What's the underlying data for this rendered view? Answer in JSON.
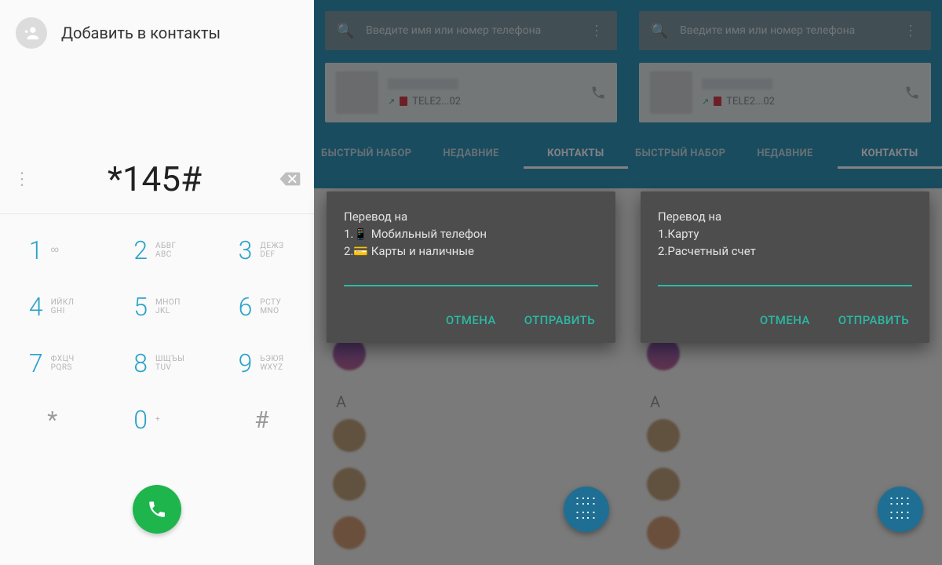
{
  "dialer": {
    "add_contact_label": "Добавить в контакты",
    "entered_number": "*145#",
    "keys": [
      {
        "d": "1",
        "top": "∞",
        "bot": ""
      },
      {
        "d": "2",
        "top": "АБВГ",
        "bot": "ABC"
      },
      {
        "d": "3",
        "top": "ДЕЖЗ",
        "bot": "DEF"
      },
      {
        "d": "4",
        "top": "ИЙКЛ",
        "bot": "GHI"
      },
      {
        "d": "5",
        "top": "МНОП",
        "bot": "JKL"
      },
      {
        "d": "6",
        "top": "РСТУ",
        "bot": "MNO"
      },
      {
        "d": "7",
        "top": "ФХЦЧ",
        "bot": "PQRS"
      },
      {
        "d": "8",
        "top": "ШЩЪЫ",
        "bot": "TUV"
      },
      {
        "d": "9",
        "top": "ЬЭЮЯ",
        "bot": "WXYZ"
      },
      {
        "sym": "*"
      },
      {
        "d": "0",
        "top": "+",
        "bot": ""
      },
      {
        "sym": "#"
      }
    ]
  },
  "contacts": {
    "search_placeholder": "Введите имя или номер телефона",
    "call_operator": "TELE2...02",
    "tabs": [
      "БЫСТРЫЙ НАБОР",
      "НЕДАВНИЕ",
      "КОНТАКТЫ"
    ],
    "active_tab": "КОНТАКТЫ",
    "section_letter": "А"
  },
  "ussd_panels": [
    {
      "title": "Перевод на",
      "lines": [
        "1.📱 Мобильный телефон",
        "2.💳 Карты и наличные"
      ],
      "cancel": "ОТМЕНА",
      "send": "ОТПРАВИТЬ"
    },
    {
      "title": "Перевод на",
      "lines": [
        "1.Карту",
        "2.Расчетный счет"
      ],
      "cancel": "ОТМЕНА",
      "send": "ОТПРАВИТЬ"
    }
  ]
}
